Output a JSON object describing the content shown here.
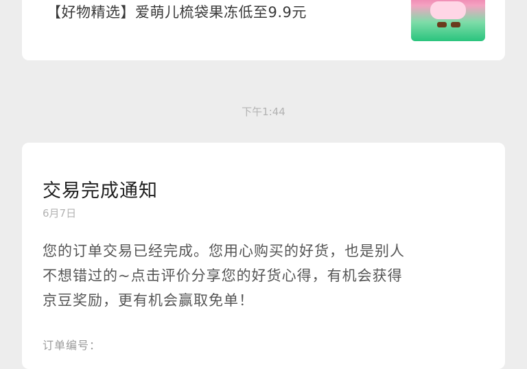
{
  "top_card": {
    "promo_text": "【好物精选】爱萌儿梳袋果冻低至9.9元"
  },
  "time_separator": "下午1:44",
  "notification": {
    "title": "交易完成通知",
    "date": "6月7日",
    "body_lines": [
      "您的订单交易已经完成。您用心购买的好货，也是别人",
      "不想错过的~点击评价分享您的好货心得，有机会获得",
      "京豆奖励，更有机会赢取免单！"
    ],
    "footer": "订单编号："
  }
}
